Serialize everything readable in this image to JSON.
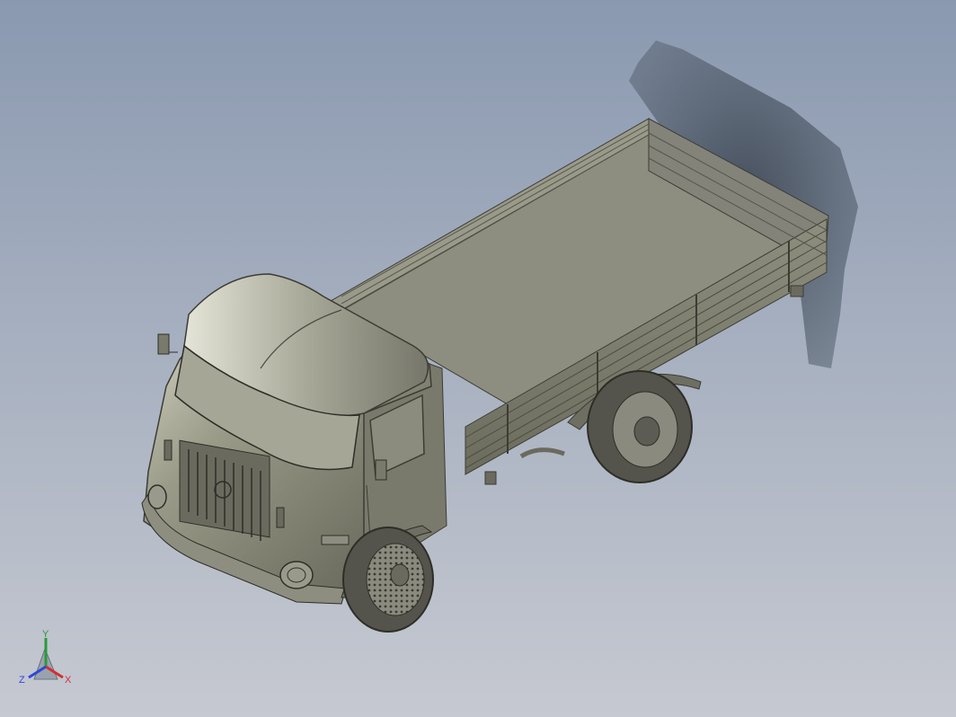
{
  "viewport": {
    "background_top": "#8a99b0",
    "background_bottom": "#c6c9d1"
  },
  "model": {
    "body_color": "#7c7c6c",
    "bed_floor_color": "#8b8b7c",
    "tire_color": "#4a4a44",
    "shadow_color": "#4f5a66"
  },
  "triad": {
    "x_label": "X",
    "y_label": "Y",
    "z_label": "Z",
    "x_color": "#d23030",
    "y_color": "#2a9a3a",
    "z_color": "#2b48d8"
  }
}
